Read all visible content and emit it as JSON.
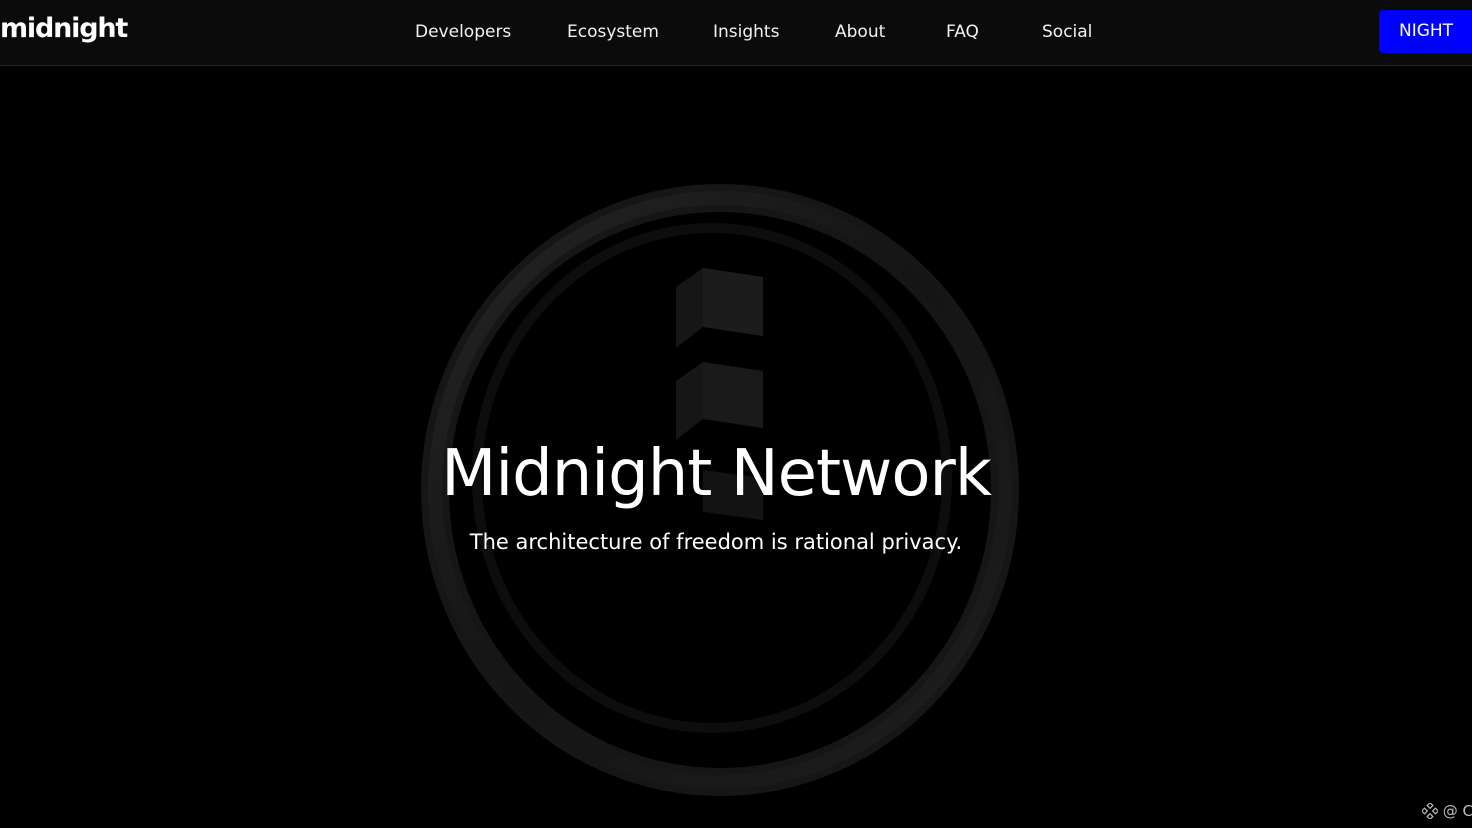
{
  "header": {
    "logo_text": "midnight",
    "nav": [
      {
        "label": "Developers"
      },
      {
        "label": "Ecosystem"
      },
      {
        "label": "Insights"
      },
      {
        "label": "About"
      },
      {
        "label": "FAQ"
      },
      {
        "label": "Social"
      }
    ],
    "cta_label": "NIGHT"
  },
  "hero": {
    "title": "Midnight Network",
    "subtitle": "The architecture of freedom is rational privacy."
  },
  "corner_widget": {
    "icon": "diamond-grid-icon",
    "text": "@ C"
  },
  "colors": {
    "background": "#000000",
    "header_background": "#0b0b0b",
    "accent": "#0000ff",
    "text": "#ffffff"
  }
}
